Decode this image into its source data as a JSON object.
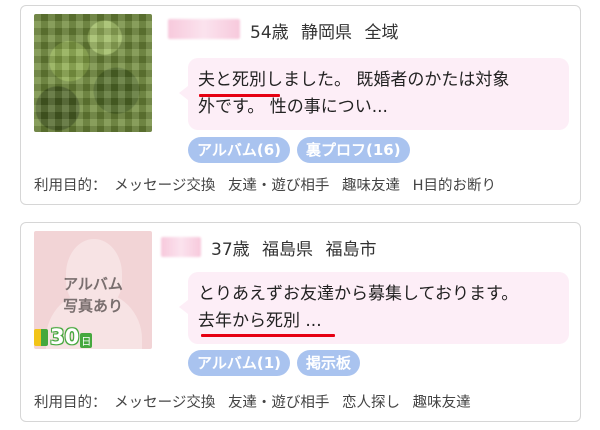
{
  "cards": [
    {
      "age": "54歳",
      "prefecture": "静岡県",
      "area": "全域",
      "message_line1_head": "夫と死別",
      "message_line1_tail": "しました。 既婚者のかたは対象",
      "message_line2": "外です。 性の事につい...",
      "tags": [
        "アルバム(6)",
        "裏プロフ(16)"
      ],
      "purpose_label": "利用目的：",
      "purposes": [
        "メッセージ交換",
        "友達・遊び相手",
        "趣味友達",
        "H目的お断り"
      ]
    },
    {
      "age": "37歳",
      "prefecture": "福島県",
      "area": "福島市",
      "photo_text_line1": "アルバム",
      "photo_text_line2": "写真あり",
      "days_badge": "30",
      "days_unit": "日",
      "message_line1": "とりあえずお友達から募集しております。",
      "message_line2_head": "去年から死別",
      "message_line2_tail": " ...",
      "tags": [
        "アルバム(1)",
        "掲示板"
      ],
      "purpose_label": "利用目的：",
      "purposes": [
        "メッセージ交換",
        "友達・遊び相手",
        "恋人探し",
        "趣味友達"
      ]
    }
  ],
  "colors": {
    "bubble": "#fdeef7",
    "tag": "#a9c3ef",
    "underline": "#e60012",
    "badge_green": "#46a83e",
    "badge_yellow": "#f2c418"
  }
}
